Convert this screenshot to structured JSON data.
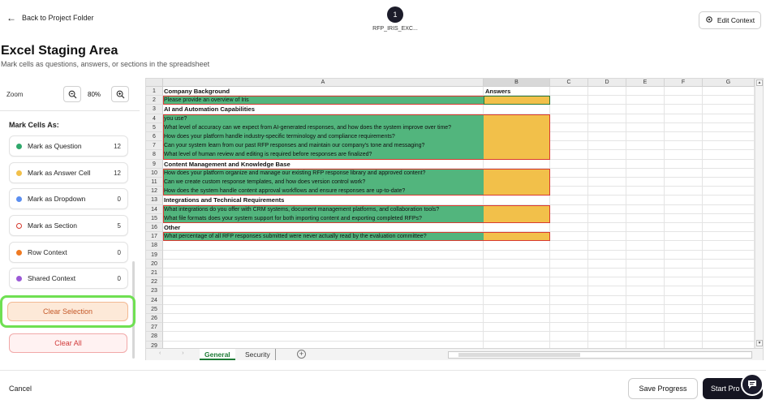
{
  "header": {
    "back_label": "Back to Project Folder",
    "step_number": "1",
    "file_name": "RFP_IRIS_EXC...",
    "edit_context_label": "Edit Context"
  },
  "page": {
    "title": "Excel Staging Area",
    "subtitle": "Mark cells as questions, answers, or sections in the spreadsheet"
  },
  "sidebar": {
    "zoom_label": "Zoom",
    "zoom_value": "80%",
    "mark_cells_title": "Mark Cells As:",
    "mark_items": [
      {
        "label": "Mark as Question",
        "count": "12",
        "color": "#2fa86b"
      },
      {
        "label": "Mark as Answer Cell",
        "count": "12",
        "color": "#f2c04a"
      },
      {
        "label": "Mark as Dropdown",
        "count": "0",
        "color": "#5b8ef0"
      },
      {
        "label": "Mark as Section",
        "count": "5",
        "color": "#d63a2e"
      },
      {
        "label": "Row Context",
        "count": "0",
        "color": "#ef7a22"
      },
      {
        "label": "Shared Context",
        "count": "0",
        "color": "#9b59d6"
      }
    ],
    "clear_selection_label": "Clear Selection",
    "clear_all_label": "Clear All"
  },
  "spreadsheet": {
    "columns": [
      "A",
      "B",
      "C",
      "D",
      "E",
      "F",
      "G"
    ],
    "rows": [
      {
        "n": "1",
        "a": "Company Background",
        "b": "Answers",
        "kind": "section"
      },
      {
        "n": "2",
        "a": "Please provide an overview of Iris",
        "b": "",
        "kind": "question"
      },
      {
        "n": "3",
        "a": "AI and Automation Capabilities",
        "b": "",
        "kind": "section"
      },
      {
        "n": "4",
        "a": "you use?",
        "b": "",
        "kind": "question"
      },
      {
        "n": "5",
        "a": "What level of accuracy can we expect from AI-generated responses, and how does the system improve over time?",
        "b": "",
        "kind": "question"
      },
      {
        "n": "6",
        "a": "How does your platform handle industry-specific terminology and compliance requirements?",
        "b": "",
        "kind": "question"
      },
      {
        "n": "7",
        "a": "Can your system learn from our past RFP responses and maintain our company's tone and messaging?",
        "b": "",
        "kind": "question"
      },
      {
        "n": "8",
        "a": "What level of human review and editing is required before responses are finalized?",
        "b": "",
        "kind": "question"
      },
      {
        "n": "9",
        "a": "Content Management and Knowledge Base",
        "b": "",
        "kind": "section"
      },
      {
        "n": "10",
        "a": "How does your platform organize and manage our existing RFP response library and approved content?",
        "b": "",
        "kind": "question"
      },
      {
        "n": "11",
        "a": "Can we create custom response templates, and how does version control work?",
        "b": "",
        "kind": "question"
      },
      {
        "n": "12",
        "a": " How does the system handle content approval workflows and ensure responses are up-to-date?",
        "b": "",
        "kind": "question"
      },
      {
        "n": "13",
        "a": "Integrations and Technical Requirements",
        "b": "",
        "kind": "section"
      },
      {
        "n": "14",
        "a": "What integrations do you offer with CRM systems, document management platforms, and collaboration tools?",
        "b": "",
        "kind": "question"
      },
      {
        "n": "15",
        "a": "What file formats does your system support for both importing content and exporting completed RFPs?",
        "b": "",
        "kind": "question"
      },
      {
        "n": "16",
        "a": "Other",
        "b": "",
        "kind": "section"
      },
      {
        "n": "17",
        "a": "What percentage of all RFP responses submitted were never actually read by the evaluation committee?",
        "b": "",
        "kind": "question"
      },
      {
        "n": "18",
        "a": "",
        "b": "",
        "kind": "empty"
      },
      {
        "n": "19",
        "a": "",
        "b": "",
        "kind": "empty"
      },
      {
        "n": "20",
        "a": "",
        "b": "",
        "kind": "empty"
      },
      {
        "n": "21",
        "a": "",
        "b": "",
        "kind": "empty"
      },
      {
        "n": "22",
        "a": "",
        "b": "",
        "kind": "empty"
      },
      {
        "n": "23",
        "a": "",
        "b": "",
        "kind": "empty"
      },
      {
        "n": "24",
        "a": "",
        "b": "",
        "kind": "empty"
      },
      {
        "n": "25",
        "a": "",
        "b": "",
        "kind": "empty"
      },
      {
        "n": "26",
        "a": "",
        "b": "",
        "kind": "empty"
      },
      {
        "n": "27",
        "a": "",
        "b": "",
        "kind": "empty"
      },
      {
        "n": "28",
        "a": "",
        "b": "",
        "kind": "empty"
      },
      {
        "n": "29",
        "a": "",
        "b": "",
        "kind": "empty"
      }
    ],
    "sheet_tabs": [
      "General",
      "Security"
    ],
    "active_tab": "General",
    "colors": {
      "question": "#52b57d",
      "answer": "#f2c04a",
      "group_border": "#d93a30"
    }
  },
  "footer": {
    "cancel_label": "Cancel",
    "save_progress_label": "Save Progress",
    "start_process_label": "Start Pro"
  }
}
